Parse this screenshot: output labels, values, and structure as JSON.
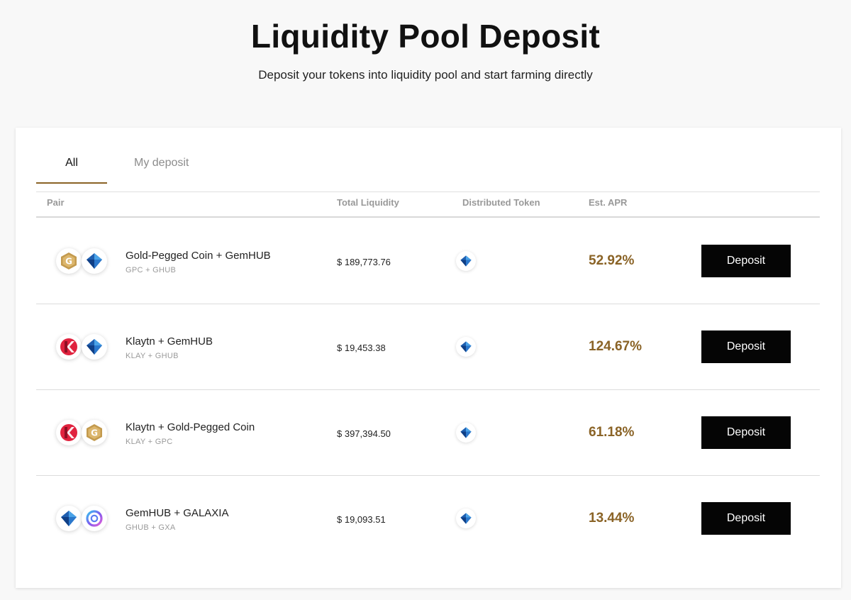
{
  "page": {
    "title": "Liquidity Pool Deposit",
    "subtitle": "Deposit your tokens into liquidity pool and start farming directly"
  },
  "tabs": [
    {
      "label": "All",
      "active": true
    },
    {
      "label": "My deposit",
      "active": false
    }
  ],
  "table": {
    "columns": [
      "Pair",
      "Total Liquidity",
      "Distributed Token",
      "Est. APR"
    ],
    "deposit_label": "Deposit",
    "rows": [
      {
        "pair": "Gold-Pegged Coin + GemHUB",
        "symbols": "GPC + GHUB",
        "icons": [
          "gpc-icon",
          "ghub-icon"
        ],
        "liquidity": "$ 189,773.76",
        "distributed_icon": "ghub-icon",
        "apr": "52.92%"
      },
      {
        "pair": "Klaytn + GemHUB",
        "symbols": "KLAY + GHUB",
        "icons": [
          "klay-icon",
          "ghub-icon"
        ],
        "liquidity": "$ 19,453.38",
        "distributed_icon": "ghub-icon",
        "apr": "124.67%"
      },
      {
        "pair": "Klaytn + Gold-Pegged Coin",
        "symbols": "KLAY + GPC",
        "icons": [
          "klay-icon",
          "gpc-icon"
        ],
        "liquidity": "$ 397,394.50",
        "distributed_icon": "ghub-icon",
        "apr": "61.18%"
      },
      {
        "pair": "GemHUB + GALAXIA",
        "symbols": "GHUB + GXA",
        "icons": [
          "ghub-icon",
          "gxa-icon"
        ],
        "liquidity": "$ 19,093.51",
        "distributed_icon": "ghub-icon",
        "apr": "13.44%"
      }
    ]
  },
  "colors": {
    "accent": "#8a6326",
    "button_bg": "#050505",
    "page_bg": "#f8f8f8"
  }
}
